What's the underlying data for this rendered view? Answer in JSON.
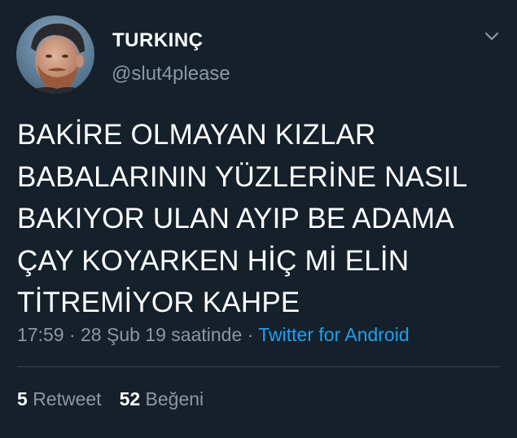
{
  "author": {
    "display_name": "TURKINÇ",
    "handle": "@slut4please",
    "avatar_icon": "user-avatar-photo"
  },
  "tweet": {
    "text": "BAKİRE OLMAYAN KIZLAR\nBABALARININ YÜZLERİNE NASIL\nBAKIYOR ULAN AYIP BE ADAMA\nÇAY KOYARKEN HİÇ Mİ ELİN\nTİTREMİYOR KAHPE"
  },
  "meta": {
    "time": "17:59",
    "separator": " · ",
    "date": "28 Şub 19 saatinde",
    "source": "Twitter for Android"
  },
  "stats": {
    "retweet_count": "5",
    "retweet_label": "Retweet",
    "like_count": "52",
    "like_label": "Beğeni"
  },
  "colors": {
    "background": "#15202b",
    "primary_text": "#ffffff",
    "secondary_text": "#8899a6",
    "link": "#1da1f2",
    "divider": "#38444d"
  },
  "icons": {
    "menu": "chevron-down-icon"
  }
}
